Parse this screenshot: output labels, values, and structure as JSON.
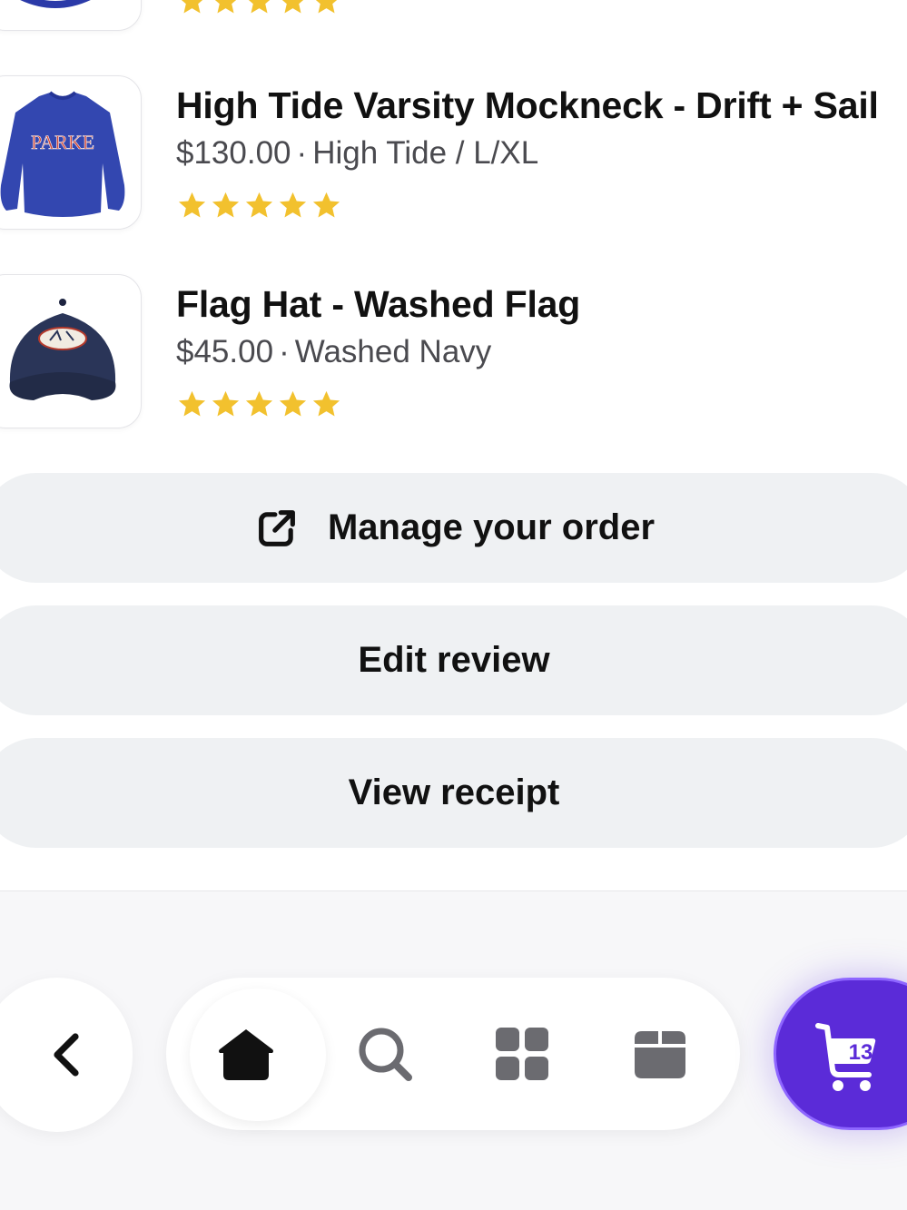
{
  "products": [
    {
      "title": "High Tide Varsity Mockneck - Drift + Sail",
      "price": "$130.00",
      "separator": "·",
      "variant": "High Tide / L/XL",
      "rating": 5,
      "thumb_icon": "navy-sweatshirt-image"
    },
    {
      "title": "Flag Hat - Washed Flag",
      "price": "$45.00",
      "separator": "·",
      "variant": "Washed Navy",
      "rating": 5,
      "thumb_icon": "navy-cap-image"
    }
  ],
  "actions": {
    "manage_order": "Manage your order",
    "edit_review": "Edit review",
    "view_receipt": "View receipt"
  },
  "nav": {
    "back_icon": "chevron-left-icon",
    "tabs": [
      "home-icon",
      "search-icon",
      "grid-icon",
      "box-icon"
    ],
    "cart_count": "13"
  },
  "colors": {
    "star": "#f2c12e",
    "cart_accent": "#5b2bd8",
    "button_bg": "#eff1f3"
  }
}
